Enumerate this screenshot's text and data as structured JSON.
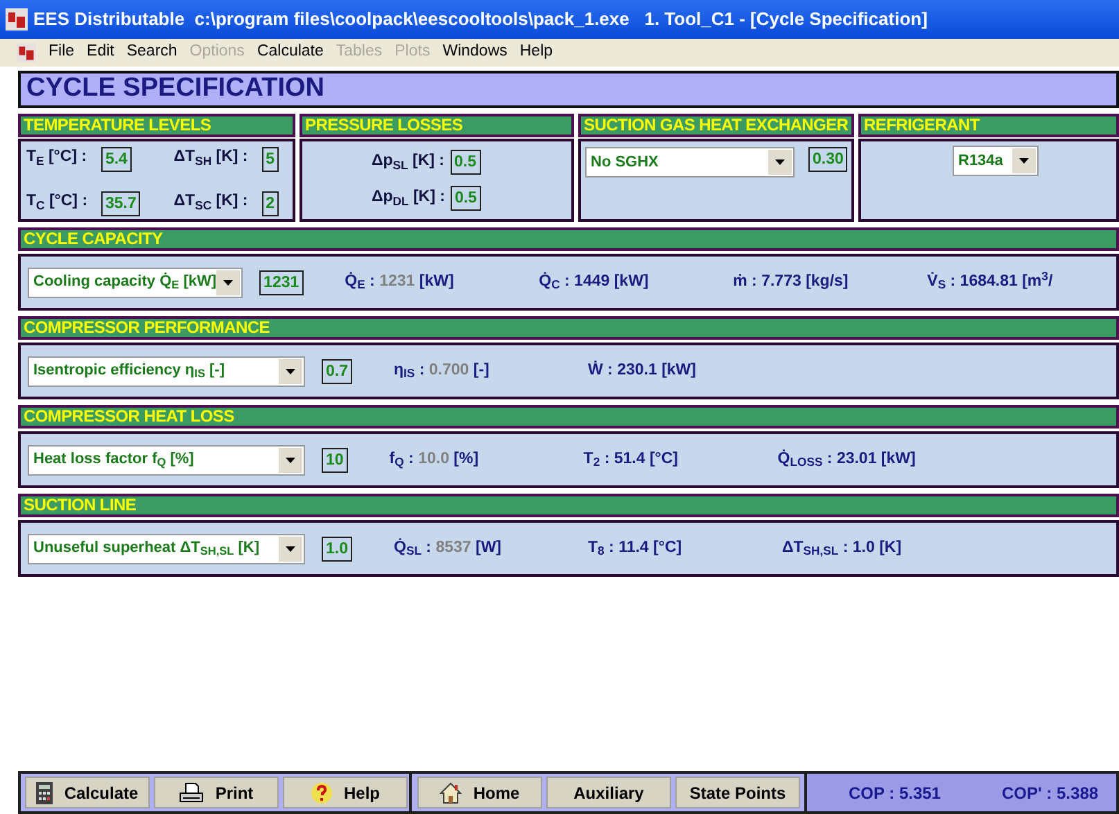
{
  "window": {
    "title": "EES Distributable  c:\\program files\\coolpack\\eescooltools\\pack_1.exe   1. Tool_C1 - [Cycle Specification]"
  },
  "menu": [
    {
      "label": "File",
      "disabled": false
    },
    {
      "label": "Edit",
      "disabled": false
    },
    {
      "label": "Search",
      "disabled": false
    },
    {
      "label": "Options",
      "disabled": true
    },
    {
      "label": "Calculate",
      "disabled": false
    },
    {
      "label": "Tables",
      "disabled": true
    },
    {
      "label": "Plots",
      "disabled": true
    },
    {
      "label": "Windows",
      "disabled": false
    },
    {
      "label": "Help",
      "disabled": false
    }
  ],
  "heading": "CYCLE SPECIFICATION",
  "temperature_levels": {
    "title": "TEMPERATURE LEVELS",
    "fields": [
      {
        "label": "T$_{E}$ [°C] :",
        "value": "5.4"
      },
      {
        "label": "ΔT$_{SH}$ [K] :",
        "value": "5"
      },
      {
        "label": "T$_{C}$ [°C] :",
        "value": "35.7"
      },
      {
        "label": "ΔT$_{SC}$ [K] :",
        "value": "2"
      }
    ]
  },
  "pressure_losses": {
    "title": "PRESSURE LOSSES",
    "fields": [
      {
        "label": "Δp$_{SL}$ [K] :",
        "value": "0.5"
      },
      {
        "label": "Δp$_{DL}$ [K] :",
        "value": "0.5"
      }
    ]
  },
  "suction_gas_heat_exchanger": {
    "title": "SUCTION GAS HEAT EXCHANGER",
    "dropdown": "No SGHX",
    "value": "0.30"
  },
  "refrigerant": {
    "title": "REFRIGERANT",
    "dropdown": "R134a"
  },
  "sections": [
    {
      "title": "CYCLE CAPACITY",
      "dropdown": "Cooling capacity Q̇$_{E}$ [kW]",
      "value": "1231",
      "results": [
        {
          "label": "Q̇$_{E}$ :",
          "value": "1231",
          "unit": "[kW]",
          "greyed": true
        },
        {
          "label": "Q̇$_{C}$ :",
          "value": "1449",
          "unit": "[kW]",
          "greyed": false
        },
        {
          "label": "ṁ :",
          "value": "7.773",
          "unit": "[kg/s]",
          "greyed": false
        },
        {
          "label": "V̇$_{S}$ :",
          "value": "1684.81",
          "unit": "[m$^{3}$/",
          "greyed": false
        }
      ]
    },
    {
      "title": "COMPRESSOR PERFORMANCE",
      "dropdown": "Isentropic efficiency η$_{IS}$ [-]",
      "value": "0.7",
      "results": [
        {
          "label": "η$_{IS}$ :",
          "value": "0.700",
          "unit": "[-]",
          "greyed": true
        },
        {
          "label": "Ẇ :",
          "value": "230.1",
          "unit": "[kW]",
          "greyed": false
        }
      ]
    },
    {
      "title": "COMPRESSOR HEAT LOSS",
      "dropdown": "Heat loss factor f$_{Q}$ [%]",
      "value": "10",
      "results": [
        {
          "label": "f$_{Q}$ :",
          "value": "10.0",
          "unit": "[%]",
          "greyed": true
        },
        {
          "label": "T$_{2}$ :",
          "value": "51.4",
          "unit": "[°C]",
          "greyed": false
        },
        {
          "label": "Q̇$_{LOSS}$ :",
          "value": "23.01",
          "unit": "[kW]",
          "greyed": false
        }
      ]
    },
    {
      "title": "SUCTION LINE",
      "dropdown": "Unuseful superheat ΔT$_{SH,SL}$ [K]",
      "value": "1.0",
      "results": [
        {
          "label": "Q̇$_{SL}$ :",
          "value": "8537",
          "unit": "[W]",
          "greyed": true
        },
        {
          "label": "T$_{8}$ :",
          "value": "11.4",
          "unit": "[°C]",
          "greyed": false
        },
        {
          "label": "ΔT$_{SH,SL}$ :",
          "value": "1.0",
          "unit": "[K]",
          "greyed": false
        }
      ]
    }
  ],
  "toolbar_groups": [
    [
      {
        "label": "Calculate",
        "kind": "calculator"
      },
      {
        "label": "Print",
        "kind": "printer"
      },
      {
        "label": "Help",
        "kind": "help"
      }
    ],
    [
      {
        "label": "Home",
        "kind": "home"
      },
      {
        "label": "Auxiliary",
        "kind": "none"
      },
      {
        "label": "State Points",
        "kind": "none"
      }
    ]
  ],
  "cop": [
    "COP : 5.351",
    "COP' : 5.388"
  ]
}
